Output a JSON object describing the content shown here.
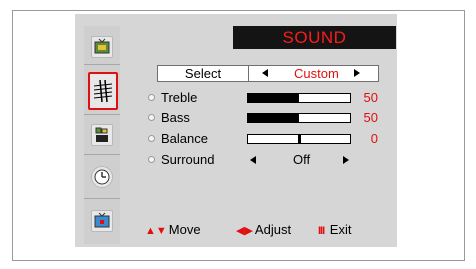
{
  "title": "SOUND",
  "select": {
    "label": "Select",
    "value": "Custom"
  },
  "settings": [
    {
      "label": "Treble",
      "value": "50",
      "level": 0.5
    },
    {
      "label": "Bass",
      "value": "50",
      "level": 0.5
    },
    {
      "label": "Balance",
      "value": "0",
      "level": 0.5
    },
    {
      "label": "Surround",
      "value": "Off"
    }
  ],
  "footer": {
    "move": "Move",
    "adjust": "Adjust",
    "exit": "Exit"
  },
  "icons": [
    "picture-icon",
    "sound-icon",
    "channel-icon",
    "setup-icon",
    "input-icon"
  ],
  "colors": {
    "accent": "#e01010",
    "title_bg": "#141414",
    "panel": "#d6d6d6"
  }
}
